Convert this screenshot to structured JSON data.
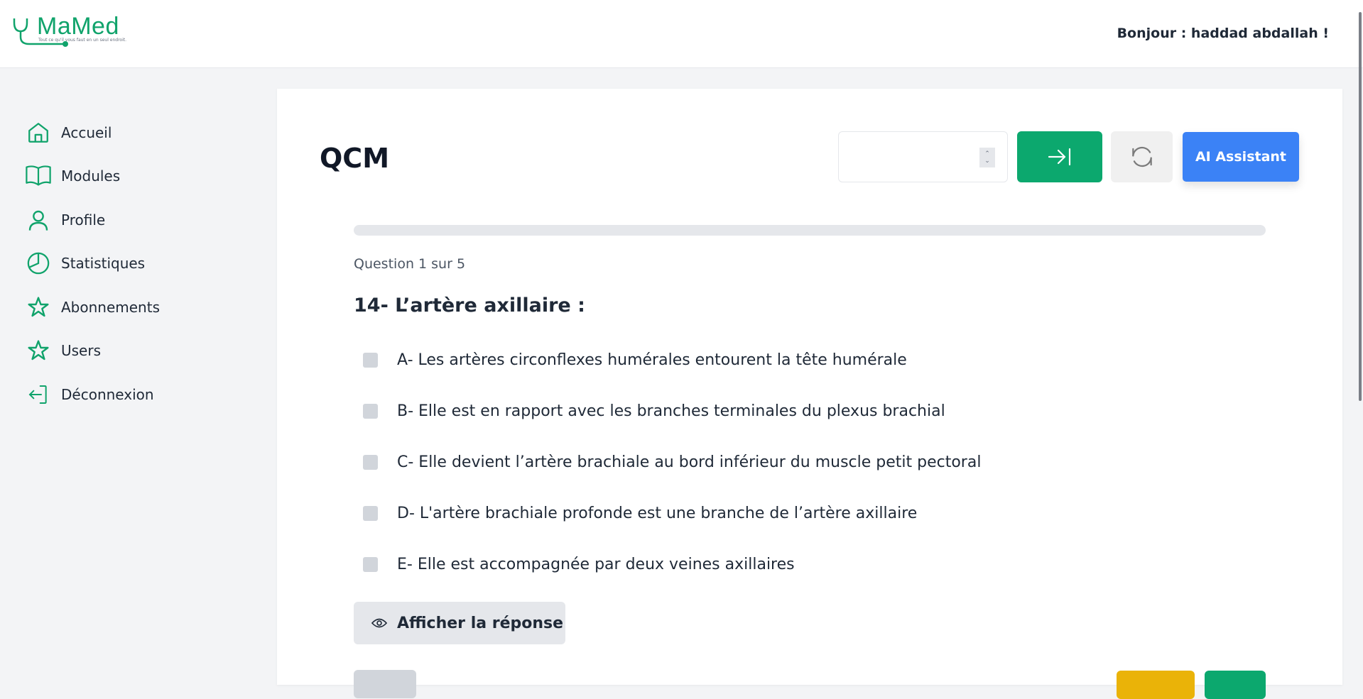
{
  "header": {
    "logo_name": "MaMed",
    "logo_tagline": "Tout ce qu'il vous faut en un seul endroit.",
    "greeting": "Bonjour : haddad abdallah !"
  },
  "sidebar": {
    "items": [
      {
        "label": "Accueil",
        "icon": "home-icon"
      },
      {
        "label": "Modules",
        "icon": "book-icon"
      },
      {
        "label": "Profile",
        "icon": "user-icon"
      },
      {
        "label": "Statistiques",
        "icon": "pie-chart-icon"
      },
      {
        "label": "Abonnements",
        "icon": "star-icon"
      },
      {
        "label": "Users",
        "icon": "star-icon"
      },
      {
        "label": "Déconnexion",
        "icon": "logout-icon"
      }
    ]
  },
  "main": {
    "title": "QCM",
    "goto_input": {
      "value": "",
      "placeholder": ""
    },
    "next_button_icon": "arrow-right-to-line-icon",
    "reset_button_icon": "refresh-icon",
    "ai_button_label": "AI Assistant",
    "progress_fraction": 0,
    "counter": "Question 1 sur 5",
    "question": "14- L’artère axillaire :",
    "options": [
      {
        "text": "A- Les artères circonflexes humérales entourent la tête humérale",
        "checked": false
      },
      {
        "text": "B- Elle est en rapport avec les branches terminales du plexus brachial",
        "checked": false
      },
      {
        "text": "C- Elle devient l’artère brachiale au bord inférieur du muscle petit pectoral",
        "checked": false
      },
      {
        "text": "D- L'artère brachiale profonde est une branche de l’artère axillaire",
        "checked": false
      },
      {
        "text": "E- Elle est accompagnée par deux veines axillaires",
        "checked": false
      }
    ],
    "show_answer_label": "Afficher la réponse"
  },
  "colors": {
    "brand_green": "#0ca86e",
    "ai_blue": "#3b82f6",
    "warning_yellow": "#eab308"
  }
}
